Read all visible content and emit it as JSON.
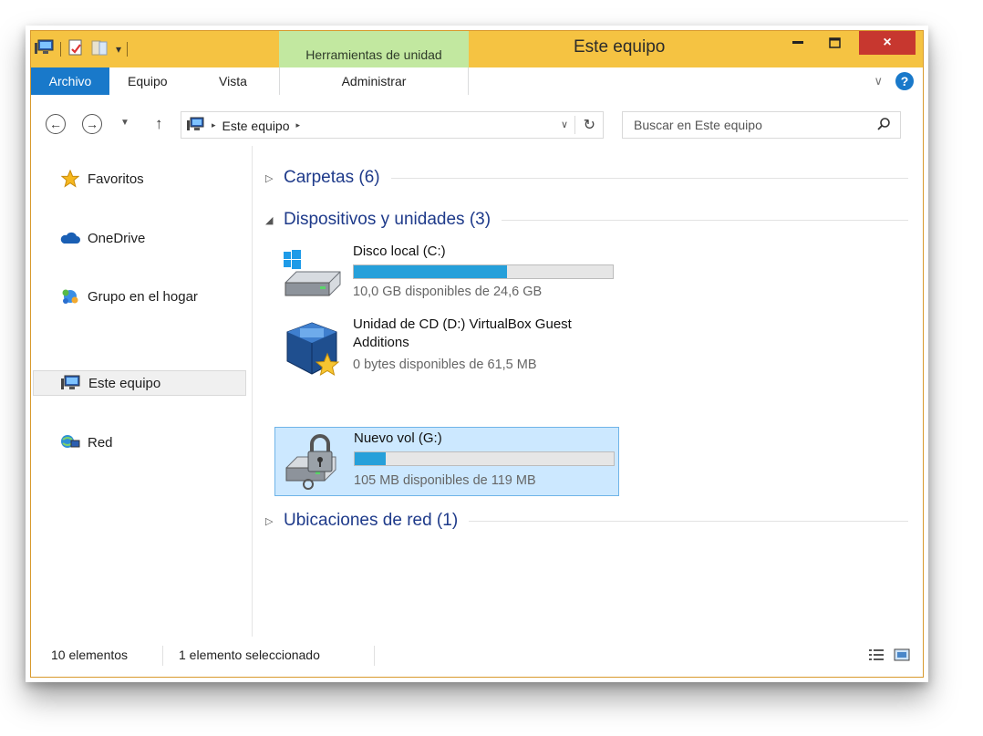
{
  "window": {
    "title": "Este equipo",
    "close_glyph": "×",
    "context_tab_header": "Herramientas de unidad"
  },
  "ribbon": {
    "tabs": [
      {
        "label": "Archivo"
      },
      {
        "label": "Equipo"
      },
      {
        "label": "Vista"
      },
      {
        "label": "Administrar"
      }
    ],
    "help_glyph": "?",
    "expand_glyph": "∨"
  },
  "navigation": {
    "back_glyph": "←",
    "forward_glyph": "→",
    "recent_glyph": "▼",
    "up_glyph": "↑",
    "address": "Este equipo",
    "crumb_arrow": "▸",
    "dropdown_glyph": "∨",
    "refresh_glyph": "↻",
    "search_placeholder": "Buscar en Este equipo"
  },
  "sidebar": {
    "items": [
      {
        "label": "Favoritos",
        "icon": "star-icon"
      },
      {
        "label": "OneDrive",
        "icon": "cloud-icon"
      },
      {
        "label": "Grupo en el hogar",
        "icon": "homegroup-icon"
      },
      {
        "label": "Este equipo",
        "icon": "computer-icon",
        "selected": true
      },
      {
        "label": "Red",
        "icon": "network-icon"
      }
    ]
  },
  "groups": [
    {
      "title": "Carpetas (6)",
      "expanded": false,
      "toggle_glyph": "▷"
    },
    {
      "title": "Dispositivos y unidades (3)",
      "expanded": true,
      "toggle_glyph": "◢"
    },
    {
      "title": "Ubicaciones de red (1)",
      "expanded": false,
      "toggle_glyph": "▷"
    }
  ],
  "drives": [
    {
      "name": "Disco local (C:)",
      "free_text": "10,0 GB disponibles de 24,6 GB",
      "used_fraction": 0.59,
      "icon": "windows-drive-icon"
    },
    {
      "name": "Unidad de CD (D:) VirtualBox Guest Additions",
      "free_text": "0 bytes disponibles de 61,5 MB",
      "icon": "virtualbox-cd-icon"
    },
    {
      "name": "Nuevo vol (G:)",
      "free_text": "105 MB disponibles de 119 MB",
      "used_fraction": 0.12,
      "icon": "locked-drive-icon",
      "selected": true
    }
  ],
  "status": {
    "count": "10 elementos",
    "selection": "1 elemento seleccionado"
  },
  "colors": {
    "titlebar": "#f5c342",
    "accent": "#1979ca",
    "close": "#c7372f",
    "bar_fill": "#26a0da",
    "selection": "#cce8ff"
  }
}
